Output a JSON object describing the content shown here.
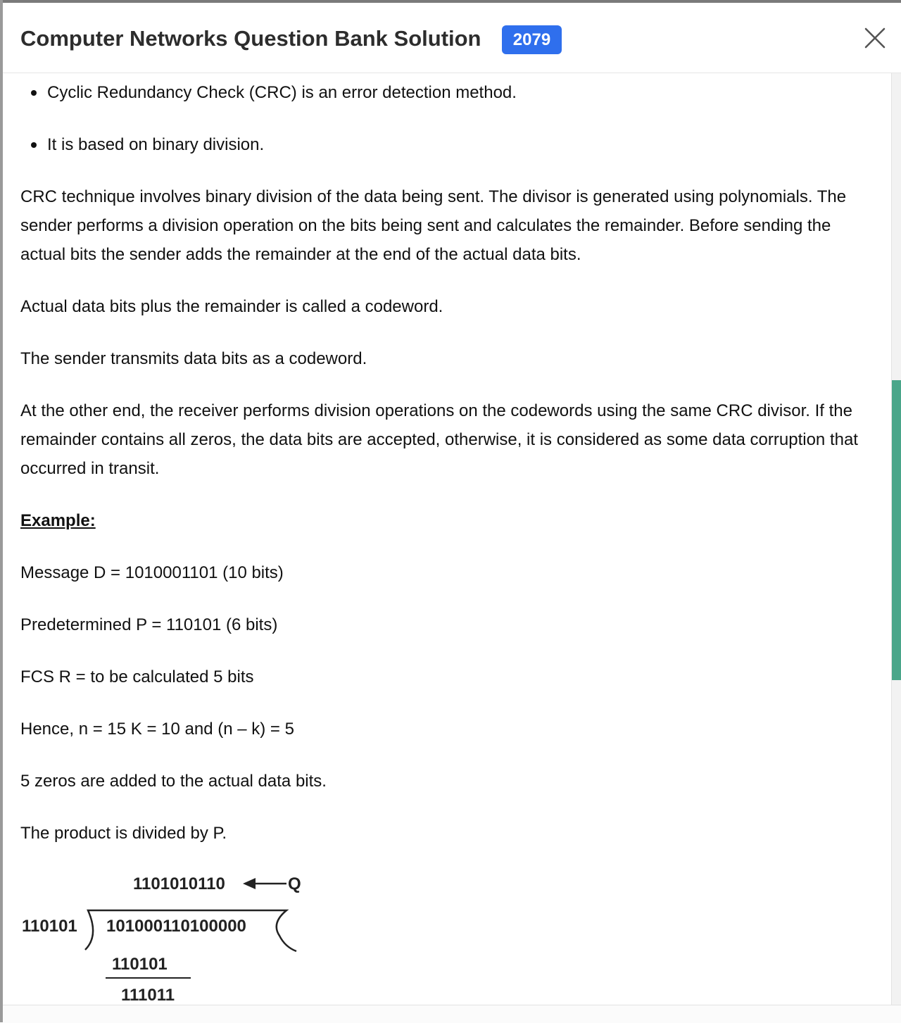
{
  "modal": {
    "title": "Computer Networks Question Bank Solution",
    "badge": "2079",
    "accent_color": "#2f6fed",
    "scrollbar_color": "#4aa68a",
    "close_icon": "close-icon"
  },
  "content": {
    "bullets": [
      "Cyclic Redundancy Check (CRC) is an error detection method.",
      "It is based on binary division."
    ],
    "paragraphs": {
      "p1": "CRC technique involves binary division of the data being sent. The divisor is generated using polynomials. The sender performs a division operation on the bits being sent and calculates the remainder. Before sending the actual bits the sender adds the remainder at the end of the actual data bits.",
      "p2": "Actual data bits plus the remainder is called a codeword.",
      "p3": "The sender transmits data bits as a codeword.",
      "p4": "At the other end, the receiver performs division operations on the codewords using the same CRC divisor. If the remainder contains all zeros, the data bits are accepted, otherwise, it is considered as some data corruption that occurred in transit."
    },
    "example_heading": "Example:",
    "example_lines": {
      "l1": "Message D = 1010001101 (10 bits)",
      "l2": "Predetermined P = 110101 (6 bits)",
      "l3": "FCS R = to be calculated 5 bits",
      "l4": "Hence, n = 15 K = 10 and (n – k) = 5",
      "l5": "5 zeros are added to the actual data bits.",
      "l6": "The product is divided by P."
    },
    "division": {
      "quotient": "1101010110",
      "quotient_label": "Q",
      "divisor": "110101",
      "dividend": "101000110100000",
      "step1": "110101",
      "step1_result": "111011"
    }
  }
}
